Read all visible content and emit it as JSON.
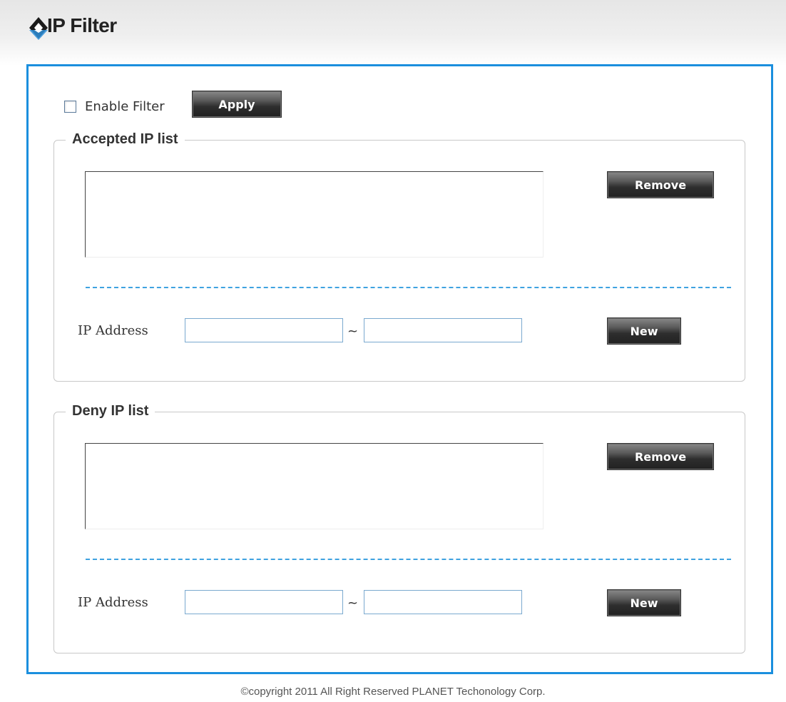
{
  "header": {
    "title": "IP Filter",
    "logo_icon": "planet-diamond-logo-icon"
  },
  "filter": {
    "enable_label": "Enable Filter",
    "enabled": false,
    "apply_label": "Apply"
  },
  "accepted": {
    "legend": "Accepted IP list",
    "items": [],
    "remove_label": "Remove",
    "ip_label": "IP Address",
    "separator": "~",
    "start_value": "",
    "end_value": "",
    "new_label": "New"
  },
  "deny": {
    "legend": "Deny IP list",
    "items": [],
    "remove_label": "Remove",
    "ip_label": "IP Address",
    "separator": "~",
    "start_value": "",
    "end_value": "",
    "new_label": "New"
  },
  "footer": {
    "copyright": "©copyright 2011 All Right Reserved PLANET Techonology Corp."
  },
  "colors": {
    "panel_border": "#1b8fde",
    "dashed_separator": "#3ea2e0",
    "input_border": "#7aa9cf",
    "button_dark": "#2e2e2e"
  }
}
